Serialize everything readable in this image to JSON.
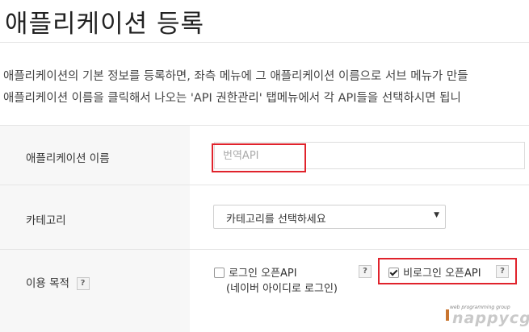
{
  "page": {
    "title": "애플리케이션 등록",
    "description_lines": [
      "애플리케이션의 기본 정보를 등록하면, 좌측 메뉴에 그 애플리케이션 이름으로 서브 메뉴가 만들",
      "애플리케이션 이름을 클릭해서 나오는 'API 권한관리' 탭메뉴에서 각 API들을 선택하시면 됩니"
    ]
  },
  "form": {
    "app_name": {
      "label": "애플리케이션 이름",
      "placeholder": "번역API",
      "value": ""
    },
    "category": {
      "label": "카테고리",
      "selected": "카테고리를 선택하세요"
    },
    "purpose": {
      "label": "이용 목적",
      "help": "?",
      "options": [
        {
          "label": "로그인 오픈API",
          "sublabel": "(네이버 아이디로 로그인)",
          "checked": false,
          "help": "?"
        },
        {
          "label": "비로그인 오픈API",
          "checked": true,
          "help": "?"
        }
      ]
    }
  },
  "watermark": {
    "tagline": "web programming group",
    "brand": "nappycgi"
  },
  "colors": {
    "highlight": "#e0232c",
    "label_bg": "#f7f7f7",
    "border": "#e5e5e5"
  }
}
